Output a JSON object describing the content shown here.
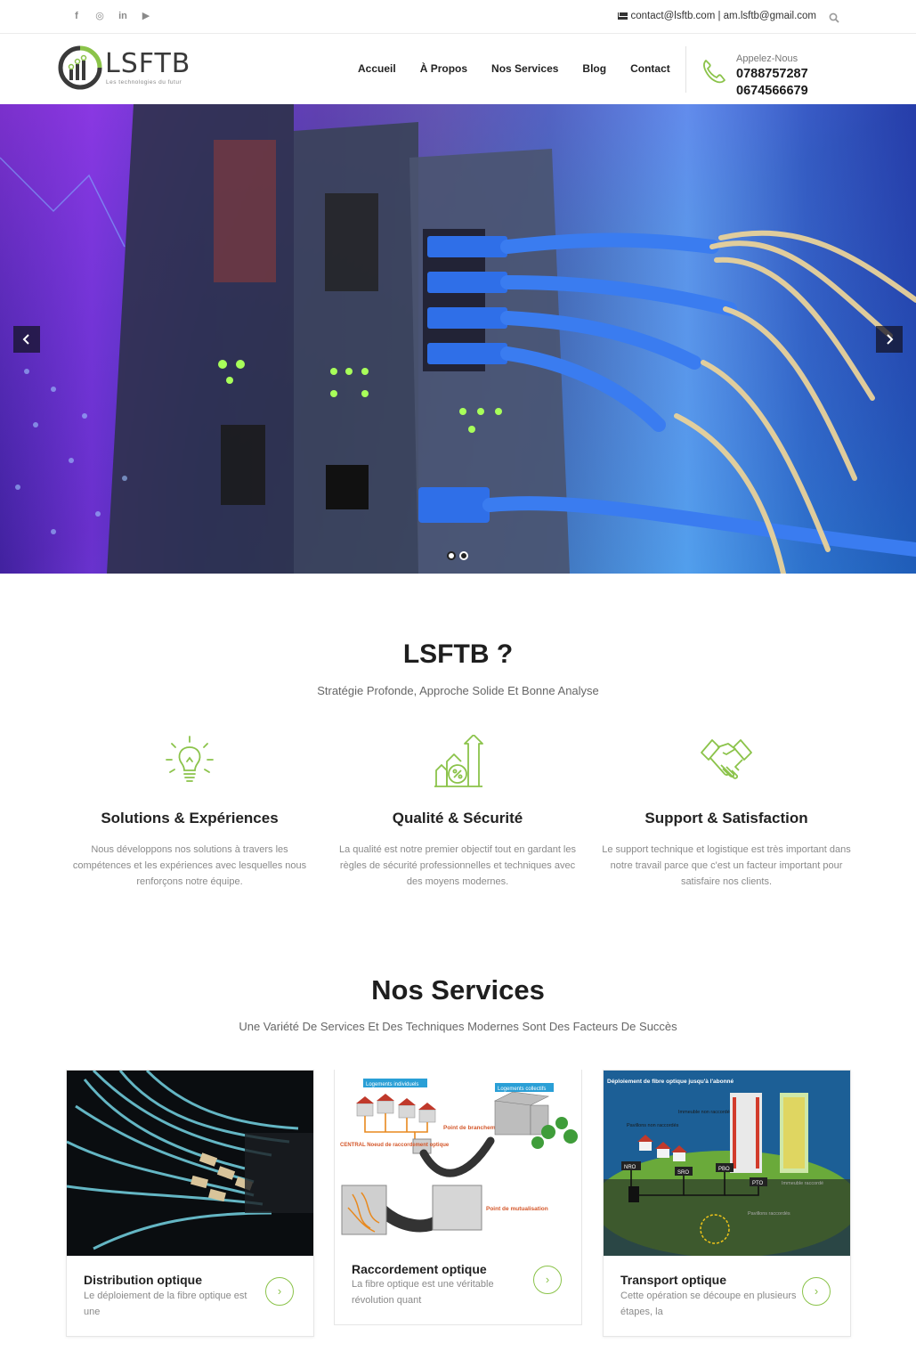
{
  "topbar": {
    "socials": [
      {
        "icon": "facebook-icon",
        "glyph": "f"
      },
      {
        "icon": "instagram-icon",
        "glyph": "◎"
      },
      {
        "icon": "linkedin-icon",
        "glyph": "in"
      },
      {
        "icon": "youtube-icon",
        "glyph": "▶"
      }
    ],
    "contact": "contact@lsftb.com | am.lsftb@gmail.com"
  },
  "header": {
    "logo_text": "LSFTB",
    "logo_tagline": "Les technologies du futur",
    "nav": [
      "Accueil",
      "À Propos",
      "Nos Services",
      "Blog",
      "Contact"
    ],
    "call_label": "Appelez-Nous",
    "phones": [
      "0788757287",
      "0674566679"
    ]
  },
  "hero": {
    "slide_count": 2,
    "active_slide": 1
  },
  "about": {
    "title": "LSFTB ?",
    "subtitle": "Stratégie Profonde, Approche Solide Et Bonne Analyse",
    "features": [
      {
        "icon": "lightbulb-icon",
        "title": "Solutions & Expériences",
        "text": "Nous développons nos solutions à travers les compétences et les expériences avec lesquelles nous renforçons notre équipe."
      },
      {
        "icon": "growth-chart-icon",
        "title": "Qualité & Sécurité",
        "text": "La qualité est notre premier objectif tout en gardant les règles de sécurité professionnelles et techniques avec des moyens modernes."
      },
      {
        "icon": "handshake-icon",
        "title": "Support & Satisfaction",
        "text": "Le support technique et logistique est très important dans notre travail parce que c'est un facteur important pour satisfaire nos clients."
      }
    ]
  },
  "services": {
    "title": "Nos Services",
    "subtitle": "Une Variété De Services Et Des Techniques Modernes Sont Des Facteurs De Succès",
    "cards": [
      {
        "title": "Distribution optique",
        "text": "Le déploiement de la fibre optique est une"
      },
      {
        "title": "Raccordement optique",
        "text": "La fibre optique est une véritable révolution quant"
      },
      {
        "title": "Transport optique",
        "text": "Cette opération se découpe en plusieurs étapes, la"
      }
    ],
    "diagram_labels": {
      "card2": [
        "Logements individuels",
        "Logements collectifs",
        "Point de branchement",
        "CENTRAL Noeud de raccordement optique",
        "Point de mutualisation"
      ],
      "card3": [
        "Déploiement de fibre optique jusqu'à l'abonné",
        "Pavillons non raccordés",
        "Immeuble non raccordé",
        "NRO",
        "SRO",
        "PBO",
        "PTO",
        "Immeuble raccordé",
        "Pavillons raccordés"
      ]
    }
  },
  "colors": {
    "accent_green": "#8bc34a",
    "text_dark": "#1e1e1e",
    "text_muted": "#8a8a8a"
  }
}
